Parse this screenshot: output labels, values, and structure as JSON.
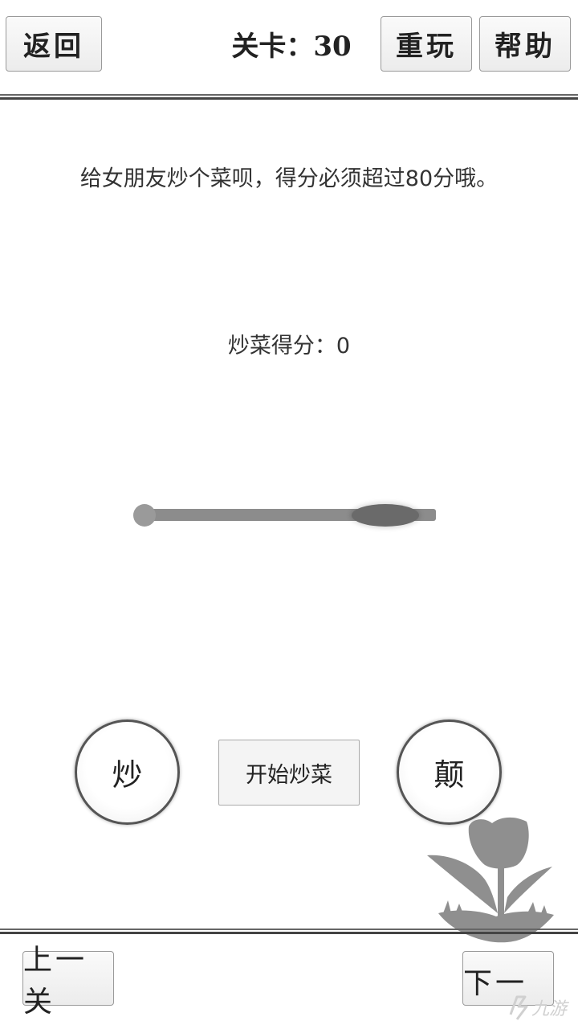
{
  "header": {
    "back_label": "返回",
    "level_title": "关卡：30",
    "replay_label": "重玩",
    "help_label": "帮助"
  },
  "game": {
    "instruction": "给女朋友炒个菜呗，得分必须超过80分哦。",
    "score_text": "炒菜得分：0",
    "stir_label": "炒",
    "start_label": "开始炒菜",
    "toss_label": "颠"
  },
  "footer": {
    "prev_label": "上一关",
    "next_label": "下一关"
  },
  "watermark": {
    "text": "九游"
  },
  "colors": {
    "background": "#ffffff",
    "button_border": "#9a9a9a",
    "slider": "#8c8c8c",
    "plant": "#8f8f8f"
  }
}
